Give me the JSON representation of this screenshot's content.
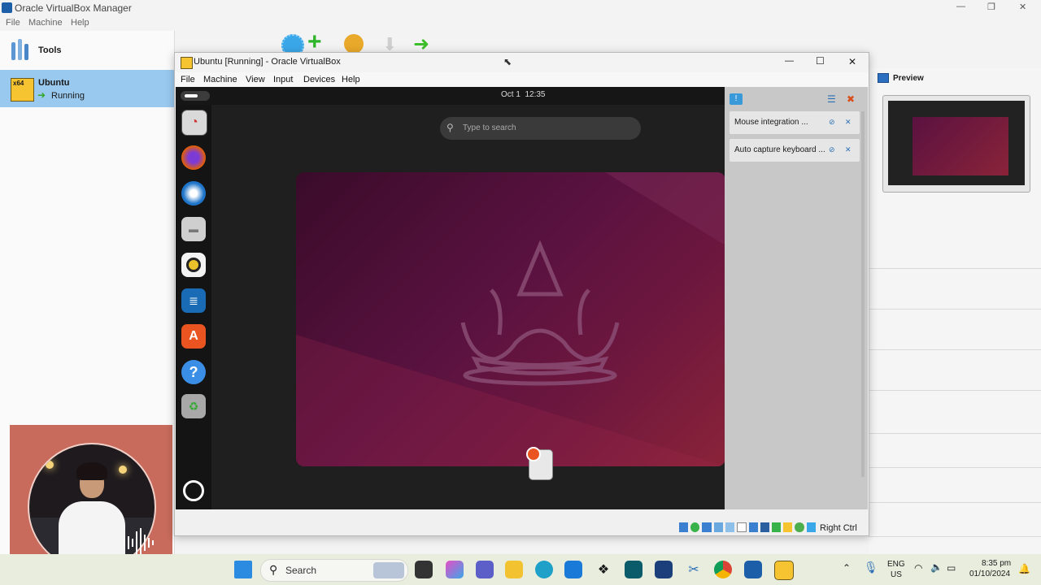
{
  "manager": {
    "title": "Oracle VirtualBox Manager",
    "menu": [
      "File",
      "Machine",
      "Help"
    ],
    "tools_label": "Tools",
    "vm": {
      "name": "Ubuntu",
      "state": "Running",
      "badge": "x64"
    },
    "preview_label": "Preview",
    "window_controls": {
      "minimize": "—",
      "maximize": "❐",
      "close": "✕"
    }
  },
  "vm_window": {
    "title": "Ubuntu [Running] - Oracle VirtualBox",
    "menu": [
      "File",
      "Machine",
      "View",
      "Input",
      "Devices",
      "Help"
    ],
    "window_controls": {
      "minimize": "—",
      "maximize": "☐",
      "close": "✕"
    },
    "status_hostkey": "Right Ctrl"
  },
  "guest": {
    "clock": "Oct 1  12:35",
    "search_placeholder": "Type to search",
    "dock": [
      {
        "name": "ubuntu-installer-icon",
        "color": "#d9d9d9"
      },
      {
        "name": "firefox-icon",
        "color": "#e66000"
      },
      {
        "name": "thunderbird-icon",
        "color": "#1d74c9"
      },
      {
        "name": "files-icon",
        "color": "#d0d0d0"
      },
      {
        "name": "rhythmbox-icon",
        "color": "#e8c12b"
      },
      {
        "name": "writer-icon",
        "color": "#1a6bb5"
      },
      {
        "name": "app-center-icon",
        "color": "#e95420"
      },
      {
        "name": "help-icon",
        "color": "#3a8ee6"
      },
      {
        "name": "trash-icon",
        "color": "#9a9a9a"
      }
    ]
  },
  "notifications": [
    {
      "text": "Mouse integration ..."
    },
    {
      "text": "Auto capture keyboard ..."
    }
  ],
  "taskbar": {
    "search_label": "Search",
    "language": "ENG",
    "region": "US",
    "time": "8:35 pm",
    "date": "01/10/2024"
  }
}
